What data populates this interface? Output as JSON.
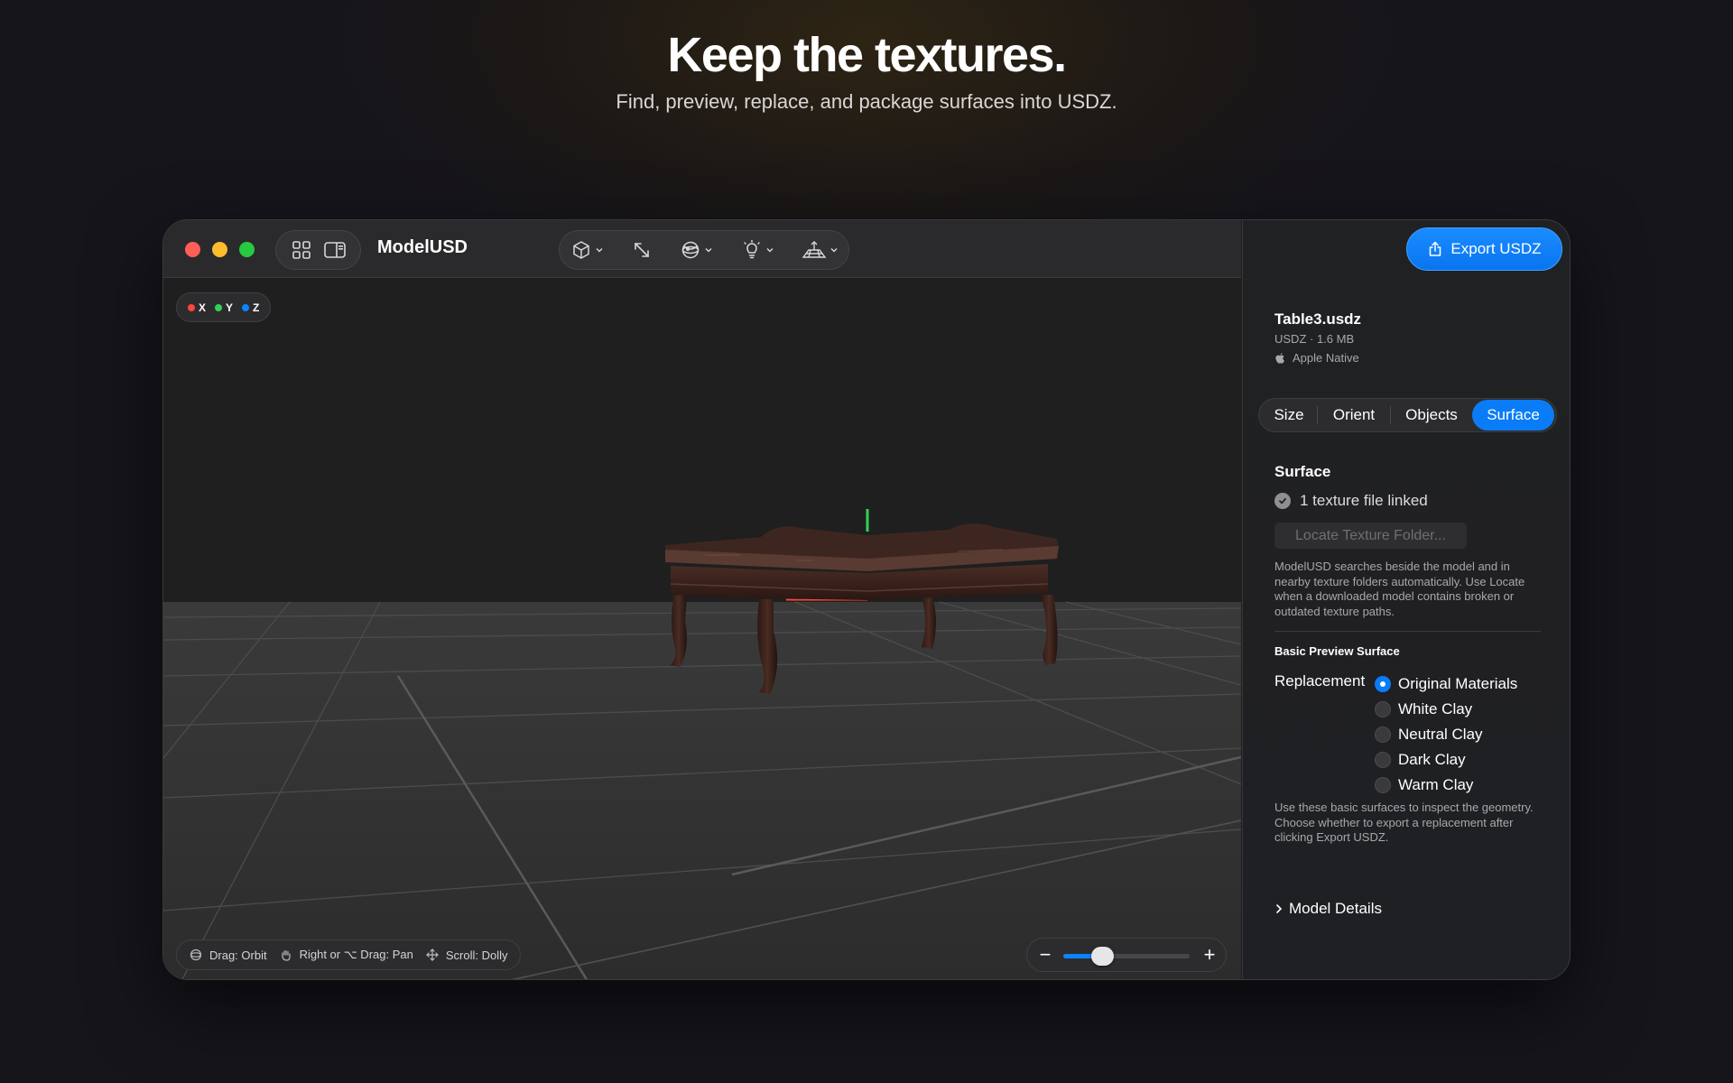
{
  "hero": {
    "title": "Keep the textures.",
    "subtitle": "Find, preview, replace, and package surfaces into USDZ."
  },
  "window": {
    "app_title": "ModelUSD",
    "toolbar": {
      "tools": [
        "cube-icon",
        "expand-arrows-icon",
        "material-sphere-icon",
        "lightbulb-icon",
        "ground-grid-icon"
      ]
    }
  },
  "viewport": {
    "axes": [
      {
        "label": "X",
        "color": "#ff453a"
      },
      {
        "label": "Y",
        "color": "#30d158"
      },
      {
        "label": "Z",
        "color": "#0a84ff"
      }
    ],
    "hints": {
      "orbit": "Drag: Orbit",
      "pan": "Right or ⌥ Drag: Pan",
      "dolly": "Scroll: Dolly"
    },
    "zoom": {
      "minus": "−",
      "plus": "+",
      "level": 0.22
    }
  },
  "sidebar": {
    "export_label": "Export USDZ",
    "file": {
      "name": "Table3.usdz",
      "meta": "USDZ · 1.6 MB",
      "native": "Apple Native"
    },
    "tabs": [
      "Size",
      "Orient",
      "Objects",
      "Surface"
    ],
    "active_tab": "Surface",
    "surface": {
      "title": "Surface",
      "linked": "1 texture file linked",
      "locate_label": "Locate Texture Folder...",
      "help": "ModelUSD searches beside the model and in nearby texture folders automatically. Use Locate when a downloaded model contains broken or outdated texture paths."
    },
    "preview": {
      "title": "Basic Preview Surface",
      "replacement_label": "Replacement",
      "options": [
        "Original Materials",
        "White Clay",
        "Neutral Clay",
        "Dark Clay",
        "Warm Clay"
      ],
      "selected": "Original Materials",
      "help": "Use these basic surfaces to inspect the geometry. Choose whether to export a replacement after clicking Export USDZ."
    },
    "details_label": "Model Details"
  },
  "colors": {
    "accent": "#0a7cf7",
    "traffic_red": "#fe5f57",
    "traffic_yellow": "#febc2e",
    "traffic_green": "#28c840"
  }
}
